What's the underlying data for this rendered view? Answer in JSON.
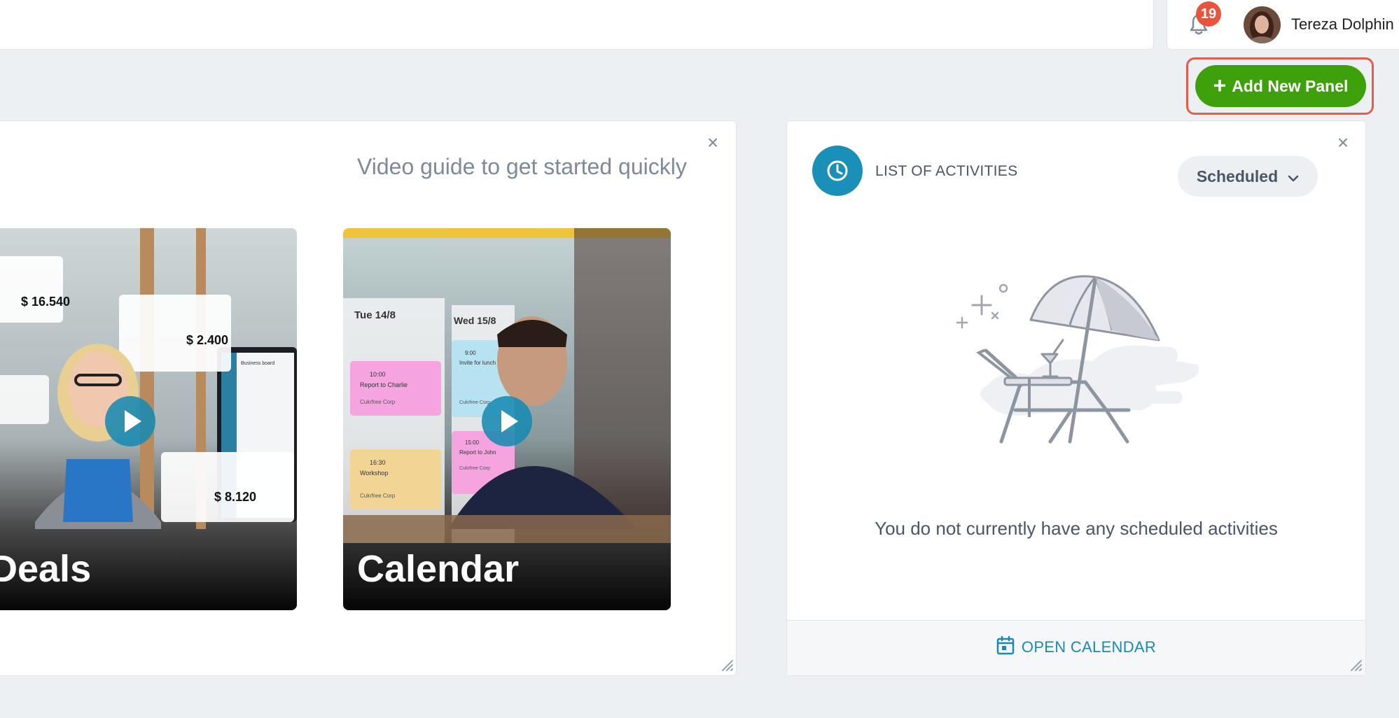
{
  "header": {
    "notification_count": "19",
    "user_name": "Tereza Dolphin"
  },
  "toolbar": {
    "add_panel_label": "Add New Panel"
  },
  "video_panel": {
    "title": "Video guide to get started quickly",
    "cards": [
      {
        "label": "Deals",
        "overlay_amounts": [
          "$ 16.540",
          "$ 2.400",
          "$ 8.120"
        ],
        "monitor_heading": "Business board"
      },
      {
        "label": "Calendar",
        "overlay_days": [
          "Tue 14/8",
          "Wed 15/8"
        ],
        "overlay_events": [
          {
            "time": "10:00",
            "title": "Report to Charlie",
            "company": "Cukrfree Corp"
          },
          {
            "time": "9:00",
            "title": "Invite for lunch",
            "company": "Cukrfree Corp"
          },
          {
            "time": "16:30",
            "title": "Workshop",
            "company": "Cukrfree Corp"
          },
          {
            "time": "15:00",
            "title": "Report to John",
            "company": "Cukrfree Corp"
          }
        ]
      }
    ]
  },
  "activities_panel": {
    "title": "LIST OF ACTIVITIES",
    "filter_value": "Scheduled",
    "empty_message": "You do not currently have any scheduled activities",
    "footer_link": "OPEN CALENDAR"
  },
  "colors": {
    "accent_green": "#3ea10b",
    "highlight_red": "#e35d4f",
    "accent_blue": "#1a90b9",
    "badge_red": "#e8553f",
    "background": "#edf0f3"
  },
  "icons": {
    "bell": "bell-icon",
    "clock": "clock-icon",
    "close": "close-icon",
    "chevron": "chevron-down-icon",
    "calendar": "calendar-icon",
    "play": "play-icon",
    "resize": "resize-handle-icon"
  }
}
